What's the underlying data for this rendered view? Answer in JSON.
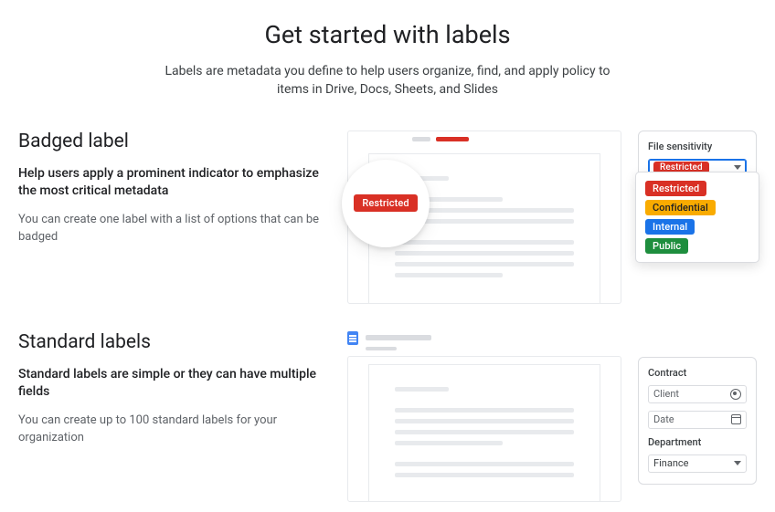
{
  "page": {
    "title": "Get started with labels",
    "subtitle": "Labels are metadata you define to help users organize, find, and apply policy to items in Drive, Docs, Sheets, and Slides"
  },
  "badged": {
    "heading": "Badged label",
    "sub": "Help users apply a prominent indicator to emphasize the most critical metadata",
    "body": "You can create one label with a list of options that can be badged",
    "bubble_label": "Restricted",
    "panel_title": "File sensitivity",
    "selected": "Restricted",
    "options": [
      {
        "label": "Restricted",
        "color": "bg-red"
      },
      {
        "label": "Confidential",
        "color": "bg-yellow"
      },
      {
        "label": "Internal",
        "color": "bg-blue"
      },
      {
        "label": "Public",
        "color": "bg-green"
      }
    ]
  },
  "standard": {
    "heading": "Standard labels",
    "sub": "Standard labels are simple or they can have multiple fields",
    "body": "You can create up to 100 standard labels for your organization",
    "group1_title": "Contract",
    "field_client": "Client",
    "field_date": "Date",
    "group2_title": "Department",
    "field_department": "Finance"
  }
}
